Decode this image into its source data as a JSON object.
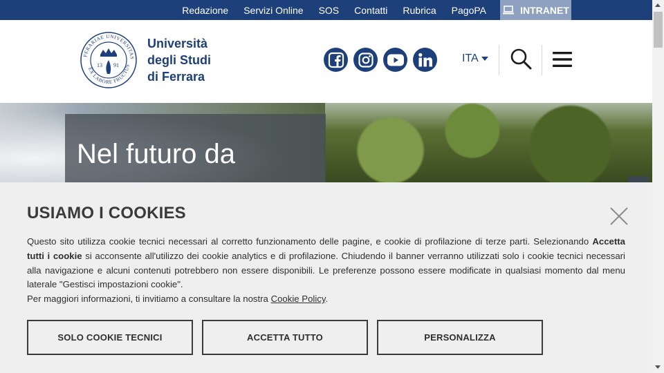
{
  "topbar": {
    "links": [
      "Redazione",
      "Servizi Online",
      "SOS",
      "Contatti",
      "Rubrica",
      "PagoPA"
    ],
    "intranet_label": "INTRANET"
  },
  "header": {
    "brand_line1": "Università",
    "brand_line2": "degli Studi",
    "brand_line3": "di Ferrara",
    "logo_ring_text": "FERARIAE UNIVERSITAS · EX LABORE FRUCTUS",
    "logo_year_left": "13",
    "logo_year_right": "91",
    "language": "ITA"
  },
  "hero": {
    "headline": "Nel futuro da"
  },
  "cookie_banner": {
    "title": "USIAMO I COOKIES",
    "text_part1": "Questo sito utilizza cookie tecnici necessari al corretto funzionamento delle pagine, e cookie di profilazione di terze parti. Selezionando ",
    "text_bold": "Accetta tutti i cookie",
    "text_part2": " si acconsente all'utilizzo dei cookie analytics e di profilazione. Chiudendo il banner verranno utilizzati solo i cookie tecnici necessari alla navigazione e alcuni contenuti potrebbero non essere disponibili. Le preferenze possono essere modificate in qualsiasi momento dal menu laterale \"Gestisci impostazioni cookie\".",
    "more_prefix": "Per maggiori informazioni, ti invitiamo a consultare la nostra ",
    "more_link": "Cookie Policy",
    "more_suffix": ".",
    "buttons": {
      "technical": "SOLO COOKIE TECNICI",
      "accept": "ACCETTA TUTTO",
      "customize": "PERSONALIZZA"
    }
  },
  "colors": {
    "brand_blue": "#1d3f7a",
    "intranet_bg": "#8ea1c0",
    "banner_bg": "#efefef"
  }
}
